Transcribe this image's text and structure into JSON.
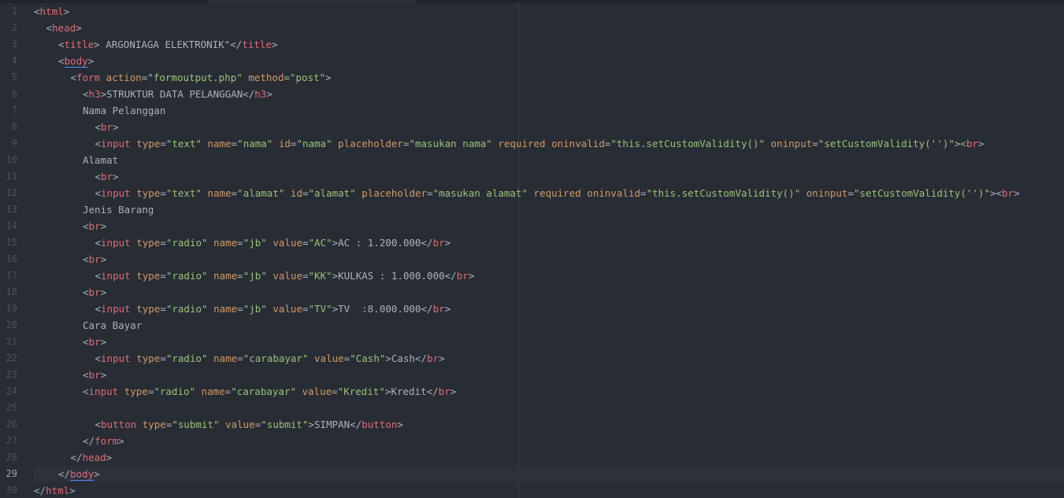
{
  "lines": [
    {
      "n": "1",
      "indent": 0,
      "tokens": [
        [
          "p",
          "<"
        ],
        [
          "t",
          "html"
        ],
        [
          "p",
          ">"
        ]
      ]
    },
    {
      "n": "2",
      "indent": 1,
      "tokens": [
        [
          "p",
          "<"
        ],
        [
          "t",
          "head"
        ],
        [
          "p",
          ">"
        ]
      ]
    },
    {
      "n": "3",
      "indent": 2,
      "tokens": [
        [
          "p",
          "<"
        ],
        [
          "t",
          "title"
        ],
        [
          "p",
          ">"
        ],
        [
          "x",
          " ARGONIAGA ELEKTRONIK\""
        ],
        [
          "p",
          "</"
        ],
        [
          "t",
          "title"
        ],
        [
          "p",
          ">"
        ]
      ]
    },
    {
      "n": "4",
      "indent": 2,
      "tokens": [
        [
          "p",
          "<"
        ],
        [
          "tu",
          "body"
        ],
        [
          "p",
          ">"
        ]
      ]
    },
    {
      "n": "5",
      "indent": 3,
      "tokens": [
        [
          "p",
          "<"
        ],
        [
          "t",
          "form"
        ],
        [
          "x",
          " "
        ],
        [
          "a",
          "action"
        ],
        [
          "p",
          "="
        ],
        [
          "s",
          "\"formoutput.php\""
        ],
        [
          "x",
          " "
        ],
        [
          "a",
          "method"
        ],
        [
          "p",
          "="
        ],
        [
          "s",
          "\"post\""
        ],
        [
          "p",
          ">"
        ]
      ]
    },
    {
      "n": "6",
      "indent": 4,
      "tokens": [
        [
          "p",
          "<"
        ],
        [
          "t",
          "h3"
        ],
        [
          "p",
          ">"
        ],
        [
          "x",
          "STRUKTUR DATA PELANGGAN"
        ],
        [
          "p",
          "</"
        ],
        [
          "t",
          "h3"
        ],
        [
          "p",
          ">"
        ]
      ]
    },
    {
      "n": "7",
      "indent": 4,
      "tokens": [
        [
          "x",
          "Nama Pelanggan"
        ]
      ]
    },
    {
      "n": "8",
      "indent": 5,
      "tokens": [
        [
          "p",
          "<"
        ],
        [
          "t",
          "br"
        ],
        [
          "p",
          ">"
        ]
      ]
    },
    {
      "n": "9",
      "indent": 5,
      "tokens": [
        [
          "p",
          "<"
        ],
        [
          "t",
          "input"
        ],
        [
          "x",
          " "
        ],
        [
          "a",
          "type"
        ],
        [
          "p",
          "="
        ],
        [
          "s",
          "\"text\""
        ],
        [
          "x",
          " "
        ],
        [
          "a",
          "name"
        ],
        [
          "p",
          "="
        ],
        [
          "s",
          "\"nama\""
        ],
        [
          "x",
          " "
        ],
        [
          "a",
          "id"
        ],
        [
          "p",
          "="
        ],
        [
          "s",
          "\"nama\""
        ],
        [
          "x",
          " "
        ],
        [
          "a",
          "placeholder"
        ],
        [
          "p",
          "="
        ],
        [
          "s",
          "\"masukan nama\""
        ],
        [
          "x",
          " "
        ],
        [
          "a",
          "required"
        ],
        [
          "x",
          " "
        ],
        [
          "a",
          "oninvalid"
        ],
        [
          "p",
          "="
        ],
        [
          "s",
          "\"this.setCustomValidity()\""
        ],
        [
          "x",
          " "
        ],
        [
          "a",
          "oninput"
        ],
        [
          "p",
          "="
        ],
        [
          "s",
          "\"setCustomValidity('')\""
        ],
        [
          "p",
          ">"
        ],
        [
          "p",
          "<"
        ],
        [
          "t",
          "br"
        ],
        [
          "p",
          ">"
        ]
      ]
    },
    {
      "n": "10",
      "indent": 4,
      "tokens": [
        [
          "x",
          "Alamat"
        ]
      ]
    },
    {
      "n": "11",
      "indent": 5,
      "tokens": [
        [
          "p",
          "<"
        ],
        [
          "t",
          "br"
        ],
        [
          "p",
          ">"
        ]
      ]
    },
    {
      "n": "12",
      "indent": 5,
      "tokens": [
        [
          "p",
          "<"
        ],
        [
          "t",
          "input"
        ],
        [
          "x",
          " "
        ],
        [
          "a",
          "type"
        ],
        [
          "p",
          "="
        ],
        [
          "s",
          "\"text\""
        ],
        [
          "x",
          " "
        ],
        [
          "a",
          "name"
        ],
        [
          "p",
          "="
        ],
        [
          "s",
          "\"alamat\""
        ],
        [
          "x",
          " "
        ],
        [
          "a",
          "id"
        ],
        [
          "p",
          "="
        ],
        [
          "s",
          "\"alamat\""
        ],
        [
          "x",
          " "
        ],
        [
          "a",
          "placeholder"
        ],
        [
          "p",
          "="
        ],
        [
          "s",
          "\"masukan alamat\""
        ],
        [
          "x",
          " "
        ],
        [
          "a",
          "required"
        ],
        [
          "x",
          " "
        ],
        [
          "a",
          "oninvalid"
        ],
        [
          "p",
          "="
        ],
        [
          "s",
          "\"this.setCustomValidity()\""
        ],
        [
          "x",
          " "
        ],
        [
          "a",
          "oninput"
        ],
        [
          "p",
          "="
        ],
        [
          "s",
          "\"setCustomValidity('')\""
        ],
        [
          "p",
          ">"
        ],
        [
          "p",
          "<"
        ],
        [
          "t",
          "br"
        ],
        [
          "p",
          ">"
        ]
      ]
    },
    {
      "n": "13",
      "indent": 4,
      "tokens": [
        [
          "x",
          "Jenis Barang"
        ]
      ]
    },
    {
      "n": "14",
      "indent": 4,
      "tokens": [
        [
          "p",
          "<"
        ],
        [
          "t",
          "br"
        ],
        [
          "p",
          ">"
        ]
      ]
    },
    {
      "n": "15",
      "indent": 5,
      "tokens": [
        [
          "p",
          "<"
        ],
        [
          "t",
          "input"
        ],
        [
          "x",
          " "
        ],
        [
          "a",
          "type"
        ],
        [
          "p",
          "="
        ],
        [
          "s",
          "\"radio\""
        ],
        [
          "x",
          " "
        ],
        [
          "a",
          "name"
        ],
        [
          "p",
          "="
        ],
        [
          "s",
          "\"jb\""
        ],
        [
          "x",
          " "
        ],
        [
          "a",
          "value"
        ],
        [
          "p",
          "="
        ],
        [
          "s",
          "\"AC\""
        ],
        [
          "p",
          ">"
        ],
        [
          "x",
          "AC : 1.200.000"
        ],
        [
          "p",
          "</"
        ],
        [
          "t",
          "br"
        ],
        [
          "p",
          ">"
        ]
      ]
    },
    {
      "n": "16",
      "indent": 4,
      "tokens": [
        [
          "p",
          "<"
        ],
        [
          "t",
          "br"
        ],
        [
          "p",
          ">"
        ]
      ]
    },
    {
      "n": "17",
      "indent": 5,
      "tokens": [
        [
          "p",
          "<"
        ],
        [
          "t",
          "input"
        ],
        [
          "x",
          " "
        ],
        [
          "a",
          "type"
        ],
        [
          "p",
          "="
        ],
        [
          "s",
          "\"radio\""
        ],
        [
          "x",
          " "
        ],
        [
          "a",
          "name"
        ],
        [
          "p",
          "="
        ],
        [
          "s",
          "\"jb\""
        ],
        [
          "x",
          " "
        ],
        [
          "a",
          "value"
        ],
        [
          "p",
          "="
        ],
        [
          "s",
          "\"KK\""
        ],
        [
          "p",
          ">"
        ],
        [
          "x",
          "KULKAS : 1.000.000"
        ],
        [
          "p",
          "</"
        ],
        [
          "t",
          "br"
        ],
        [
          "p",
          ">"
        ]
      ]
    },
    {
      "n": "18",
      "indent": 4,
      "tokens": [
        [
          "p",
          "<"
        ],
        [
          "t",
          "br"
        ],
        [
          "p",
          ">"
        ]
      ]
    },
    {
      "n": "19",
      "indent": 5,
      "tokens": [
        [
          "p",
          "<"
        ],
        [
          "t",
          "input"
        ],
        [
          "x",
          " "
        ],
        [
          "a",
          "type"
        ],
        [
          "p",
          "="
        ],
        [
          "s",
          "\"radio\""
        ],
        [
          "x",
          " "
        ],
        [
          "a",
          "name"
        ],
        [
          "p",
          "="
        ],
        [
          "s",
          "\"jb\""
        ],
        [
          "x",
          " "
        ],
        [
          "a",
          "value"
        ],
        [
          "p",
          "="
        ],
        [
          "s",
          "\"TV\""
        ],
        [
          "p",
          ">"
        ],
        [
          "x",
          "TV  :8.000.000"
        ],
        [
          "p",
          "</"
        ],
        [
          "t",
          "br"
        ],
        [
          "p",
          ">"
        ]
      ]
    },
    {
      "n": "20",
      "indent": 4,
      "tokens": [
        [
          "x",
          "Cara Bayar"
        ]
      ]
    },
    {
      "n": "21",
      "indent": 4,
      "tokens": [
        [
          "p",
          "<"
        ],
        [
          "t",
          "br"
        ],
        [
          "p",
          ">"
        ]
      ]
    },
    {
      "n": "22",
      "indent": 5,
      "tokens": [
        [
          "p",
          "<"
        ],
        [
          "t",
          "input"
        ],
        [
          "x",
          " "
        ],
        [
          "a",
          "type"
        ],
        [
          "p",
          "="
        ],
        [
          "s",
          "\"radio\""
        ],
        [
          "x",
          " "
        ],
        [
          "a",
          "name"
        ],
        [
          "p",
          "="
        ],
        [
          "s",
          "\"carabayar\""
        ],
        [
          "x",
          " "
        ],
        [
          "a",
          "value"
        ],
        [
          "p",
          "="
        ],
        [
          "s",
          "\"Cash\""
        ],
        [
          "p",
          ">"
        ],
        [
          "x",
          "Cash"
        ],
        [
          "p",
          "</"
        ],
        [
          "t",
          "br"
        ],
        [
          "p",
          ">"
        ]
      ]
    },
    {
      "n": "23",
      "indent": 4,
      "tokens": [
        [
          "p",
          "<"
        ],
        [
          "t",
          "br"
        ],
        [
          "p",
          ">"
        ]
      ]
    },
    {
      "n": "24",
      "indent": 4,
      "tokens": [
        [
          "p",
          "<"
        ],
        [
          "t",
          "input"
        ],
        [
          "x",
          " "
        ],
        [
          "a",
          "type"
        ],
        [
          "p",
          "="
        ],
        [
          "s",
          "\"radio\""
        ],
        [
          "x",
          " "
        ],
        [
          "a",
          "name"
        ],
        [
          "p",
          "="
        ],
        [
          "s",
          "\"carabayar\""
        ],
        [
          "x",
          " "
        ],
        [
          "a",
          "value"
        ],
        [
          "p",
          "="
        ],
        [
          "s",
          "\"Kredit\""
        ],
        [
          "p",
          ">"
        ],
        [
          "x",
          "Kredit"
        ],
        [
          "p",
          "</"
        ],
        [
          "t",
          "br"
        ],
        [
          "p",
          ">"
        ]
      ]
    },
    {
      "n": "25",
      "indent": 0,
      "tokens": []
    },
    {
      "n": "26",
      "indent": 5,
      "tokens": [
        [
          "p",
          "<"
        ],
        [
          "t",
          "button"
        ],
        [
          "x",
          " "
        ],
        [
          "a",
          "type"
        ],
        [
          "p",
          "="
        ],
        [
          "s",
          "\"submit\""
        ],
        [
          "x",
          " "
        ],
        [
          "a",
          "value"
        ],
        [
          "p",
          "="
        ],
        [
          "s",
          "\"submit\""
        ],
        [
          "p",
          ">"
        ],
        [
          "x",
          "SIMPAN"
        ],
        [
          "p",
          "</"
        ],
        [
          "t",
          "button"
        ],
        [
          "p",
          ">"
        ]
      ]
    },
    {
      "n": "27",
      "indent": 4,
      "tokens": [
        [
          "p",
          "</"
        ],
        [
          "t",
          "form"
        ],
        [
          "p",
          ">"
        ]
      ]
    },
    {
      "n": "28",
      "indent": 3,
      "tokens": [
        [
          "p",
          "</"
        ],
        [
          "t",
          "head"
        ],
        [
          "p",
          ">"
        ]
      ]
    },
    {
      "n": "29",
      "indent": 2,
      "active": true,
      "tokens": [
        [
          "p",
          "</"
        ],
        [
          "tu",
          "body"
        ],
        [
          "p",
          ">"
        ]
      ]
    },
    {
      "n": "30",
      "indent": 0,
      "tokens": [
        [
          "p",
          "</"
        ],
        [
          "t",
          "html"
        ],
        [
          "p",
          ">"
        ]
      ]
    }
  ]
}
